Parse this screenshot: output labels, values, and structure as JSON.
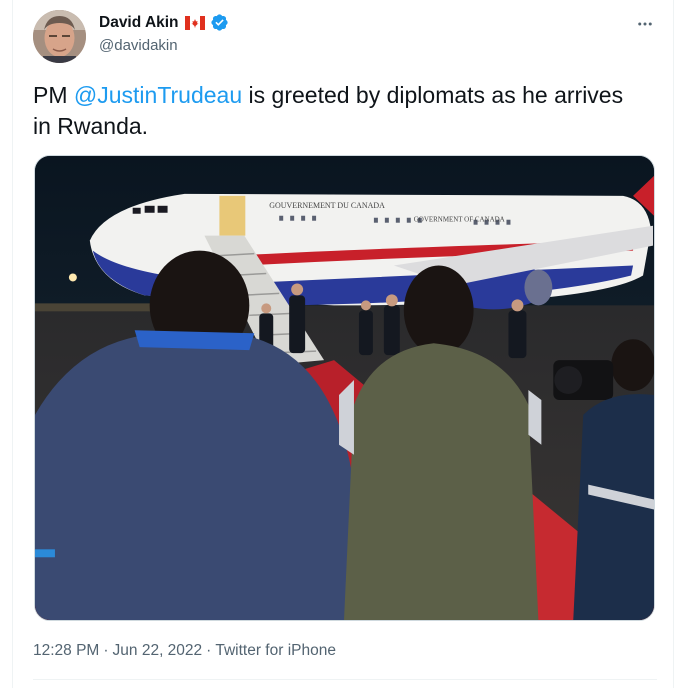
{
  "author": {
    "display_name": "David Akin",
    "handle": "@davidakin",
    "verified": true,
    "flag": "Canada flag emoji"
  },
  "tweet": {
    "text_prefix": "PM ",
    "mention": "@JustinTrudeau",
    "text_suffix": " is greeted by diplomats as he arrives in Rwanda.",
    "media_description": "Photo of Canadian government Airbus at night on tarmac, people on stairs and red carpet, diplomats and photographers in foreground",
    "aircraft_livery_text_1": "GOUVERNEMENT DU CANADA",
    "aircraft_livery_text_2": "GOVERNMENT OF CANADA"
  },
  "meta": {
    "time": "12:28 PM",
    "separator": "·",
    "date": "Jun 22, 2022",
    "source": "Twitter for iPhone"
  },
  "colors": {
    "link": "#1d9bf0",
    "secondary_text": "#536471",
    "primary_text": "#0f1419",
    "verified_badge": "#1d9bf0"
  },
  "icons": {
    "more": "more-dots-icon",
    "verified": "verified-badge-icon"
  }
}
